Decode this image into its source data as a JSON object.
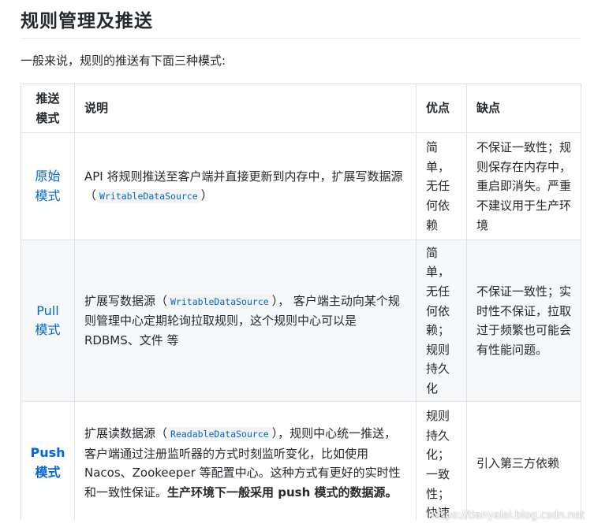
{
  "heading": "规则管理及推送",
  "intro": "一般来说，规则的推送有下面三种模式:",
  "table": {
    "headers": {
      "mode_line1": "推送",
      "mode_line2": "模式",
      "description": "说明",
      "pros": "优点",
      "cons": "缺点"
    },
    "rows": [
      {
        "mode_line1": "原始",
        "mode_line2": "模式",
        "desc_before": "API 将规则推送至客户端并直接更新到内存中，扩展写数据源（",
        "desc_code": "WritableDataSource",
        "desc_after": "）",
        "pros_lines": [
          "简",
          "单，",
          "无任",
          "何依",
          "赖"
        ],
        "cons": "不保证一致性；规则保存在内存中，重启即消失。严重不建议用于生产环境"
      },
      {
        "mode_line1": "Pull",
        "mode_line2": "模式",
        "desc_before": "扩展写数据源（",
        "desc_code": "WritableDataSource",
        "desc_after": "）， 客户端主动向某个规则管理中心定期轮询拉取规则，这个规则中心可以是 RDBMS、文件 等",
        "pros_lines": [
          "简",
          "单，",
          "无任",
          "何依",
          "赖；",
          "规则",
          "持久",
          "化"
        ],
        "cons": "不保证一致性；实时性不保证，拉取过于频繁也可能会有性能问题。"
      },
      {
        "mode_line1": "Push",
        "mode_line2": "模式",
        "desc_before": "扩展读数据源（",
        "desc_code": "ReadableDataSource",
        "desc_after": "），规则中心统一推送，客户端通过注册监听器的方式时刻监听变化，比如使用 Nacos、Zookeeper 等配置中心。这种方式有更好的实时性和一致性保证。",
        "desc_bold": "生产环境下一般采用 push 模式的数据源。",
        "pros_lines": [
          "规则",
          "持久",
          "化；",
          "一致",
          "性；",
          "快速"
        ],
        "cons": "引入第三方依赖"
      }
    ]
  },
  "watermark": "https://tianyalei.blog.csdn.net"
}
